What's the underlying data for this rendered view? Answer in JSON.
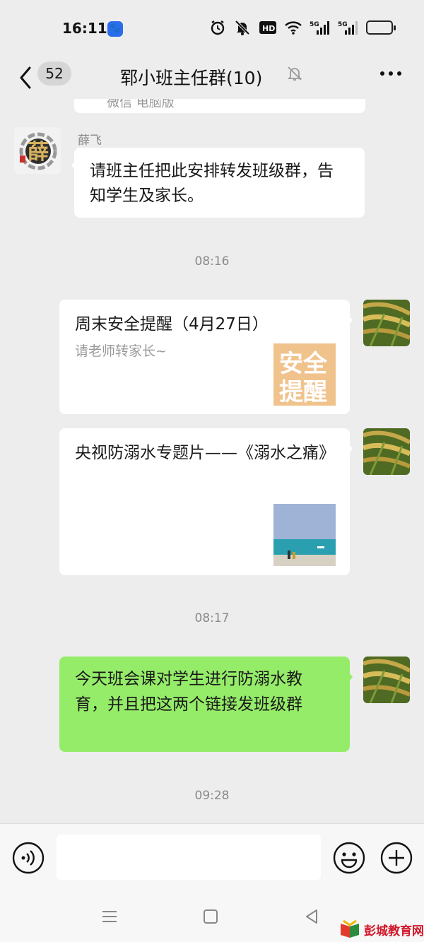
{
  "status_bar": {
    "time": "16:11",
    "battery_color": "#f5b800",
    "icons": [
      "baidu-app-icon",
      "alarm-icon",
      "mute-bell-icon",
      "hd-icon",
      "wifi-icon",
      "5g-signal-icon",
      "5g-signal-icon",
      "battery-icon"
    ],
    "network_label_1": "5G",
    "network_label_2": "5G",
    "hd_label": "HD"
  },
  "nav": {
    "unread_count": "52",
    "title": "郓小班主任群(10)",
    "icons": [
      "back-arrow-icon",
      "muted-bell-icon",
      "more-icon"
    ]
  },
  "chat": {
    "partial_text": "微信 电脑版",
    "messages": [
      {
        "sender": "薛飞",
        "text": "请班主任把此安排转发班级群，告知学生及家长。"
      }
    ],
    "timestamps": [
      "08:16",
      "08:17",
      "09:28"
    ],
    "cards": [
      {
        "title": "周末安全提醒（4月27日）",
        "desc": "请老师转家长~",
        "thumb_text": [
          "安全",
          "提醒"
        ]
      },
      {
        "title": "央视防溺水专题片——《溺水之痛》",
        "desc": ""
      }
    ],
    "self_message": "今天班会课对学生进行防溺水教育，并且把这两个链接发班级群"
  },
  "input_bar": {
    "placeholder": "",
    "icons": [
      "voice-icon",
      "emoji-icon",
      "plus-icon"
    ]
  },
  "system_nav": {
    "icons": [
      "menu-icon",
      "home-icon",
      "back-triangle-icon"
    ]
  },
  "watermark": {
    "text": "彭城教育网"
  },
  "colors": {
    "background": "#ededed",
    "self_bubble": "#95ec69",
    "other_bubble": "#ffffff",
    "watermark": "#d2172a"
  }
}
